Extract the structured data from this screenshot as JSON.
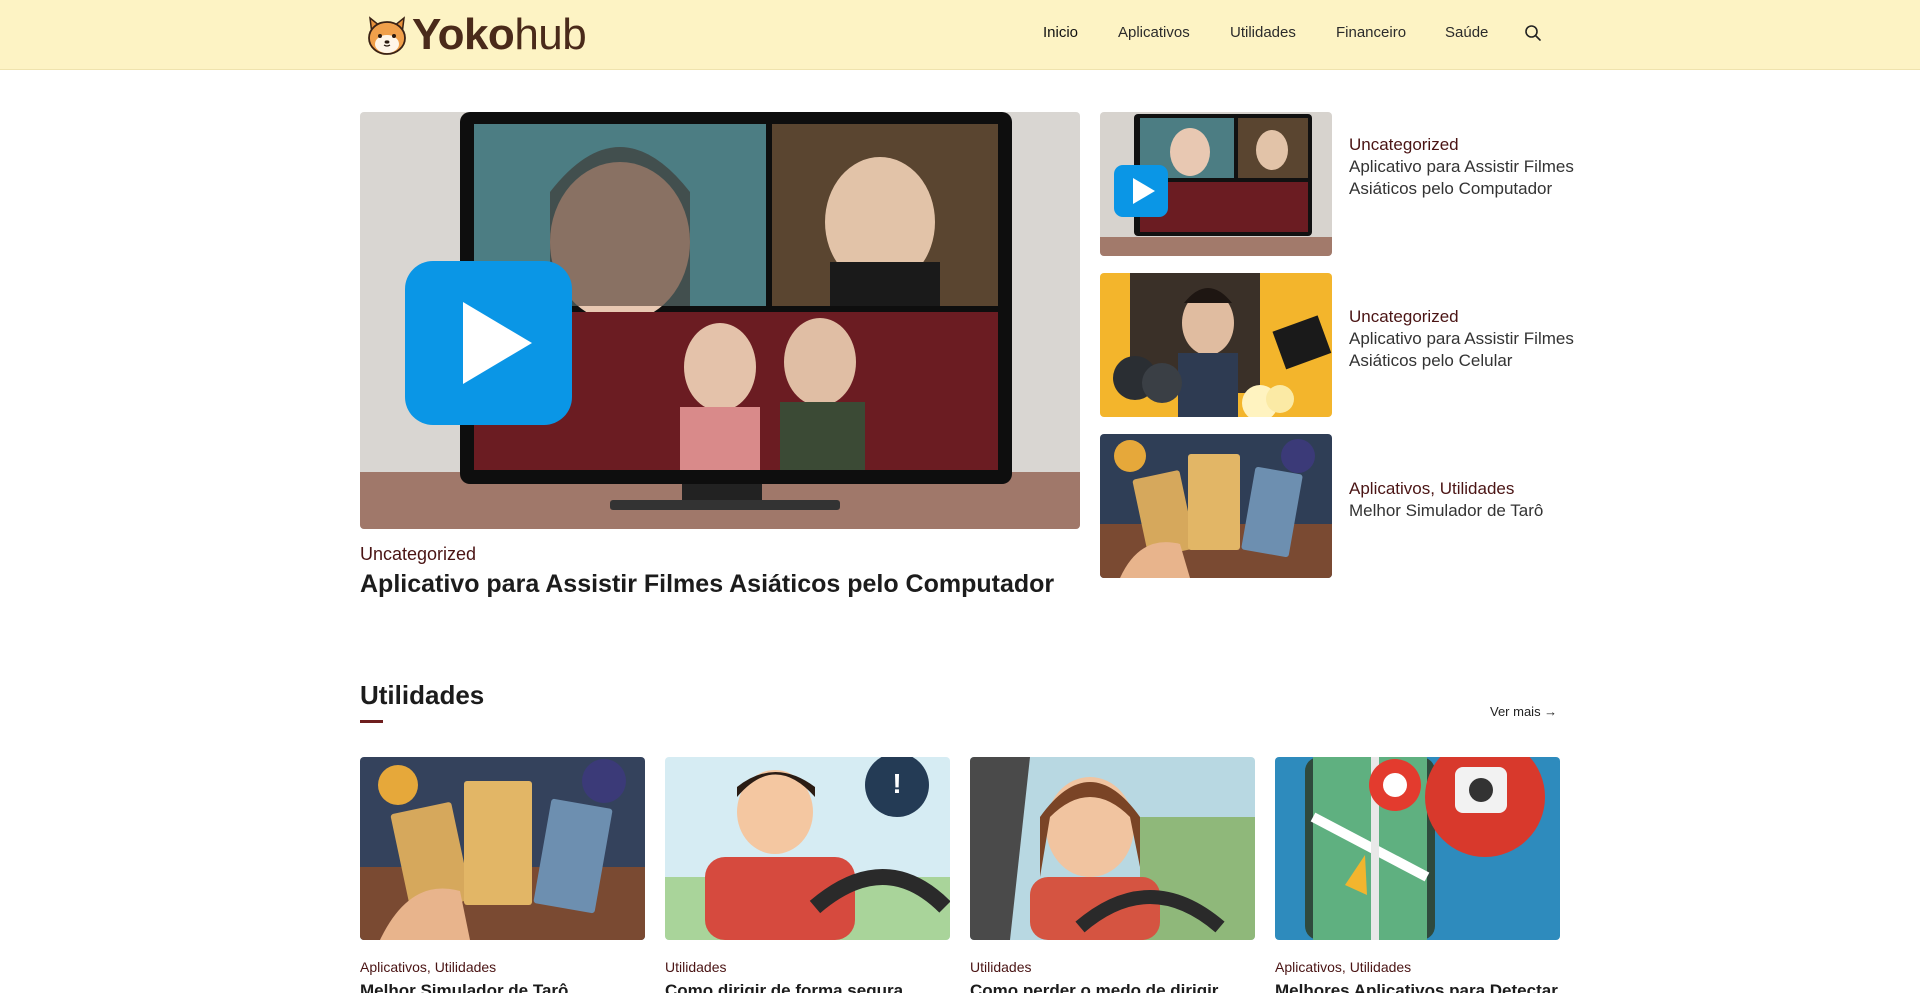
{
  "header": {
    "logo_bold": "Yoko",
    "logo_light": "hub",
    "nav": [
      {
        "label": "Inicio"
      },
      {
        "label": "Aplicativos"
      },
      {
        "label": "Utilidades"
      },
      {
        "label": "Financeiro"
      },
      {
        "label": "Saúde"
      }
    ],
    "search_icon": "search-icon"
  },
  "hero": {
    "category": "Uncategorized",
    "title": "Aplicativo para Assistir Filmes Asiáticos pelo Computador"
  },
  "side_posts": [
    {
      "category": "Uncategorized",
      "title": "Aplicativo para Assistir Filmes Asiáticos pelo Computador"
    },
    {
      "category": "Uncategorized",
      "title": "Aplicativo para Assistir Filmes Asiáticos pelo Celular"
    },
    {
      "category": "Aplicativos, Utilidades",
      "title": "Melhor Simulador de Tarô"
    }
  ],
  "section": {
    "title": "Utilidades",
    "see_more": "Ver mais →"
  },
  "cards": [
    {
      "category": "Aplicativos, Utilidades",
      "title": "Melhor Simulador de Tarô"
    },
    {
      "category": "Utilidades",
      "title": "Como dirigir de forma segura"
    },
    {
      "category": "Utilidades",
      "title": "Como perder o medo de dirigir"
    },
    {
      "category": "Aplicativos, Utilidades",
      "title": "Melhores Aplicativos para Detectar"
    }
  ],
  "colors": {
    "header_bg": "#fdf3c4",
    "category": "#4a1414",
    "accent_underline": "#6e1e1e",
    "play_blue": "#0a96e6"
  }
}
